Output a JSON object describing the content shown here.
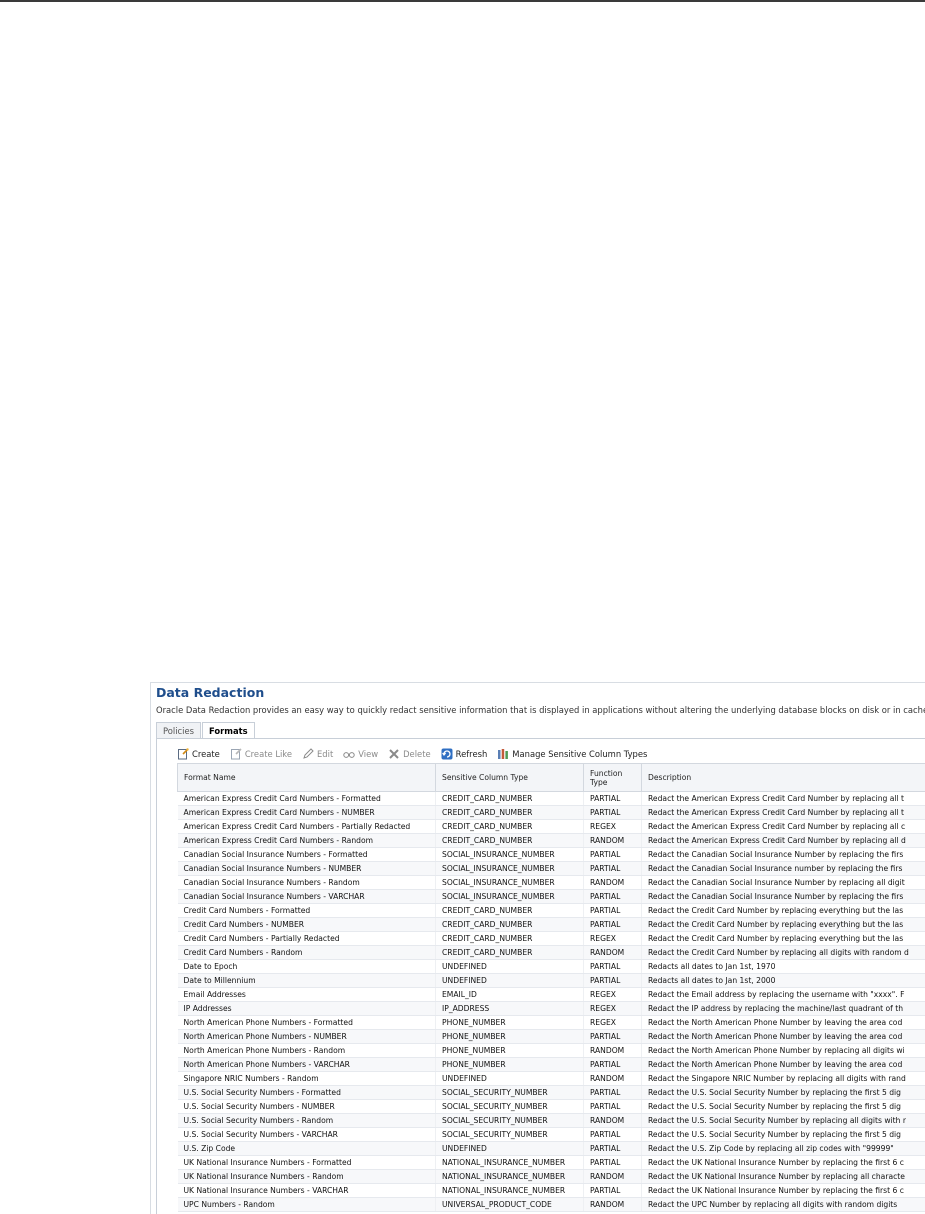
{
  "header": {
    "title": "Data Redaction",
    "description": "Oracle Data Redaction provides an easy way to quickly redact sensitive information that is displayed in applications without altering the underlying database blocks on disk or in cache."
  },
  "tabs": [
    {
      "label": "Policies",
      "active": false
    },
    {
      "label": "Formats",
      "active": true
    }
  ],
  "toolbar": {
    "create": "Create",
    "create_like": "Create Like",
    "edit": "Edit",
    "view": "View",
    "delete": "Delete",
    "refresh": "Refresh",
    "manage": "Manage Sensitive Column Types"
  },
  "table": {
    "columns": {
      "format_name": "Format Name",
      "sensitive_column_type": "Sensitive Column Type",
      "function_type": "Function Type",
      "description": "Description"
    },
    "rows": [
      {
        "name": "American Express Credit Card Numbers - Formatted",
        "type": "CREDIT_CARD_NUMBER",
        "func": "PARTIAL",
        "desc": "Redact the American Express Credit Card Number by replacing all t"
      },
      {
        "name": "American Express Credit Card Numbers - NUMBER",
        "type": "CREDIT_CARD_NUMBER",
        "func": "PARTIAL",
        "desc": "Redact the American Express Credit Card Number by replacing all t"
      },
      {
        "name": "American Express Credit Card Numbers - Partially Redacted",
        "type": "CREDIT_CARD_NUMBER",
        "func": "REGEX",
        "desc": "Redact the American Express Credit Card Number by replacing all c"
      },
      {
        "name": "American Express Credit Card Numbers - Random",
        "type": "CREDIT_CARD_NUMBER",
        "func": "RANDOM",
        "desc": "Redact the American Express Credit Card Number by replacing all d"
      },
      {
        "name": "Canadian Social Insurance Numbers - Formatted",
        "type": "SOCIAL_INSURANCE_NUMBER",
        "func": "PARTIAL",
        "desc": "Redact the Canadian Social Insurance Number by replacing the firs"
      },
      {
        "name": "Canadian Social Insurance Numbers - NUMBER",
        "type": "SOCIAL_INSURANCE_NUMBER",
        "func": "PARTIAL",
        "desc": "Redact the Canadian Social Insurance number by replacing the firs"
      },
      {
        "name": "Canadian Social Insurance Numbers - Random",
        "type": "SOCIAL_INSURANCE_NUMBER",
        "func": "RANDOM",
        "desc": "Redact the Canadian Social Insurance Number by replacing all digit"
      },
      {
        "name": "Canadian Social Insurance Numbers - VARCHAR",
        "type": "SOCIAL_INSURANCE_NUMBER",
        "func": "PARTIAL",
        "desc": "Redact the Canadian Social Insurance Number by replacing the firs"
      },
      {
        "name": "Credit Card Numbers - Formatted",
        "type": "CREDIT_CARD_NUMBER",
        "func": "PARTIAL",
        "desc": "Redact the Credit Card Number by replacing everything but the las"
      },
      {
        "name": "Credit Card Numbers - NUMBER",
        "type": "CREDIT_CARD_NUMBER",
        "func": "PARTIAL",
        "desc": "Redact the Credit Card Number by replacing everything but the las"
      },
      {
        "name": "Credit Card Numbers - Partially Redacted",
        "type": "CREDIT_CARD_NUMBER",
        "func": "REGEX",
        "desc": "Redact the Credit Card Number by replacing everything but the las"
      },
      {
        "name": "Credit Card Numbers - Random",
        "type": "CREDIT_CARD_NUMBER",
        "func": "RANDOM",
        "desc": "Redact the Credit Card Number by replacing all digits with random d"
      },
      {
        "name": "Date to Epoch",
        "type": "UNDEFINED",
        "func": "PARTIAL",
        "desc": "Redacts all dates to Jan 1st, 1970"
      },
      {
        "name": "Date to Millennium",
        "type": "UNDEFINED",
        "func": "PARTIAL",
        "desc": "Redacts all dates to Jan 1st, 2000"
      },
      {
        "name": "Email Addresses",
        "type": "EMAIL_ID",
        "func": "REGEX",
        "desc": "Redact the Email address by replacing the username with \"xxxx\". F"
      },
      {
        "name": "IP Addresses",
        "type": "IP_ADDRESS",
        "func": "REGEX",
        "desc": "Redact the IP address by replacing the machine/last quadrant of th"
      },
      {
        "name": "North American Phone Numbers - Formatted",
        "type": "PHONE_NUMBER",
        "func": "REGEX",
        "desc": "Redact the North American Phone Number by leaving the area cod"
      },
      {
        "name": "North American Phone Numbers - NUMBER",
        "type": "PHONE_NUMBER",
        "func": "PARTIAL",
        "desc": "Redact the North American Phone Number by leaving the area cod"
      },
      {
        "name": "North American Phone Numbers - Random",
        "type": "PHONE_NUMBER",
        "func": "RANDOM",
        "desc": "Redact the North American Phone Number by replacing all digits wi"
      },
      {
        "name": "North American Phone Numbers - VARCHAR",
        "type": "PHONE_NUMBER",
        "func": "PARTIAL",
        "desc": "Redact the North American Phone Number by leaving the area cod"
      },
      {
        "name": "Singapore NRIC Numbers - Random",
        "type": "UNDEFINED",
        "func": "RANDOM",
        "desc": "Redact the Singapore NRIC Number by replacing all digits with rand"
      },
      {
        "name": "U.S. Social Security Numbers - Formatted",
        "type": "SOCIAL_SECURITY_NUMBER",
        "func": "PARTIAL",
        "desc": "Redact the U.S. Social Security Number by replacing the first 5 dig"
      },
      {
        "name": "U.S. Social Security Numbers - NUMBER",
        "type": "SOCIAL_SECURITY_NUMBER",
        "func": "PARTIAL",
        "desc": "Redact the U.S. Social Security Number by replacing the first 5 dig"
      },
      {
        "name": "U.S. Social Security Numbers - Random",
        "type": "SOCIAL_SECURITY_NUMBER",
        "func": "RANDOM",
        "desc": "Redact the U.S. Social Security Number by replacing all digits with r"
      },
      {
        "name": "U.S. Social Security Numbers - VARCHAR",
        "type": "SOCIAL_SECURITY_NUMBER",
        "func": "PARTIAL",
        "desc": "Redact the U.S. Social Security Number by replacing the first 5 dig"
      },
      {
        "name": "U.S. Zip Code",
        "type": "UNDEFINED",
        "func": "PARTIAL",
        "desc": "Redact the U.S. Zip Code by replacing all zip codes with \"99999\""
      },
      {
        "name": "UK National Insurance Numbers - Formatted",
        "type": "NATIONAL_INSURANCE_NUMBER",
        "func": "PARTIAL",
        "desc": "Redact the UK National Insurance Number by replacing the first 6 c"
      },
      {
        "name": "UK National Insurance Numbers - Random",
        "type": "NATIONAL_INSURANCE_NUMBER",
        "func": "RANDOM",
        "desc": "Redact the UK National Insurance Number by replacing all characte"
      },
      {
        "name": "UK National Insurance Numbers - VARCHAR",
        "type": "NATIONAL_INSURANCE_NUMBER",
        "func": "PARTIAL",
        "desc": "Redact the UK National Insurance Number by replacing the first 6 c"
      },
      {
        "name": "UPC Numbers - Random",
        "type": "UNIVERSAL_PRODUCT_CODE",
        "func": "RANDOM",
        "desc": "Redact the UPC Number by replacing all digits with random digits"
      }
    ]
  },
  "icons": {
    "create": "create-icon",
    "create_like": "create-like-icon",
    "edit": "pencil-icon",
    "view": "glasses-icon",
    "delete": "delete-x-icon",
    "refresh": "refresh-icon",
    "manage": "columns-icon"
  },
  "colors": {
    "title": "#1f4e8c",
    "header_bg": "#f3f5f8",
    "alt_row": "#f7f8fa"
  }
}
